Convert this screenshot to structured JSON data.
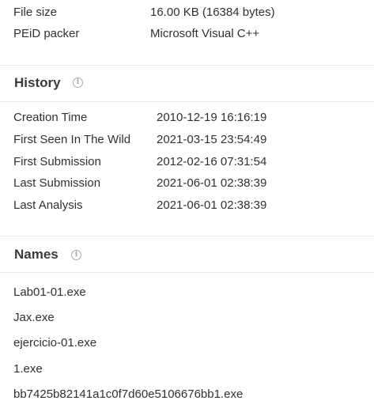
{
  "properties": [
    {
      "label": "File size",
      "value": "16.00 KB (16384 bytes)"
    },
    {
      "label": "PEiD packer",
      "value": "Microsoft Visual C++"
    }
  ],
  "history": {
    "title": "History",
    "icon": "info-icon",
    "rows": [
      {
        "label": "Creation Time",
        "value": "2010-12-19 16:16:19"
      },
      {
        "label": "First Seen In The Wild",
        "value": "2021-03-15 23:54:49"
      },
      {
        "label": "First Submission",
        "value": "2012-02-16 07:31:54"
      },
      {
        "label": "Last Submission",
        "value": "2021-06-01 02:38:39"
      },
      {
        "label": "Last Analysis",
        "value": "2021-06-01 02:38:39"
      }
    ]
  },
  "names": {
    "title": "Names",
    "icon": "info-icon",
    "items": [
      "Lab01-01.exe",
      "Jax.exe",
      "ejercicio-01.exe",
      "1.exe",
      "bb7425b82141a1c0f7d60e5106676bb1.exe"
    ]
  }
}
